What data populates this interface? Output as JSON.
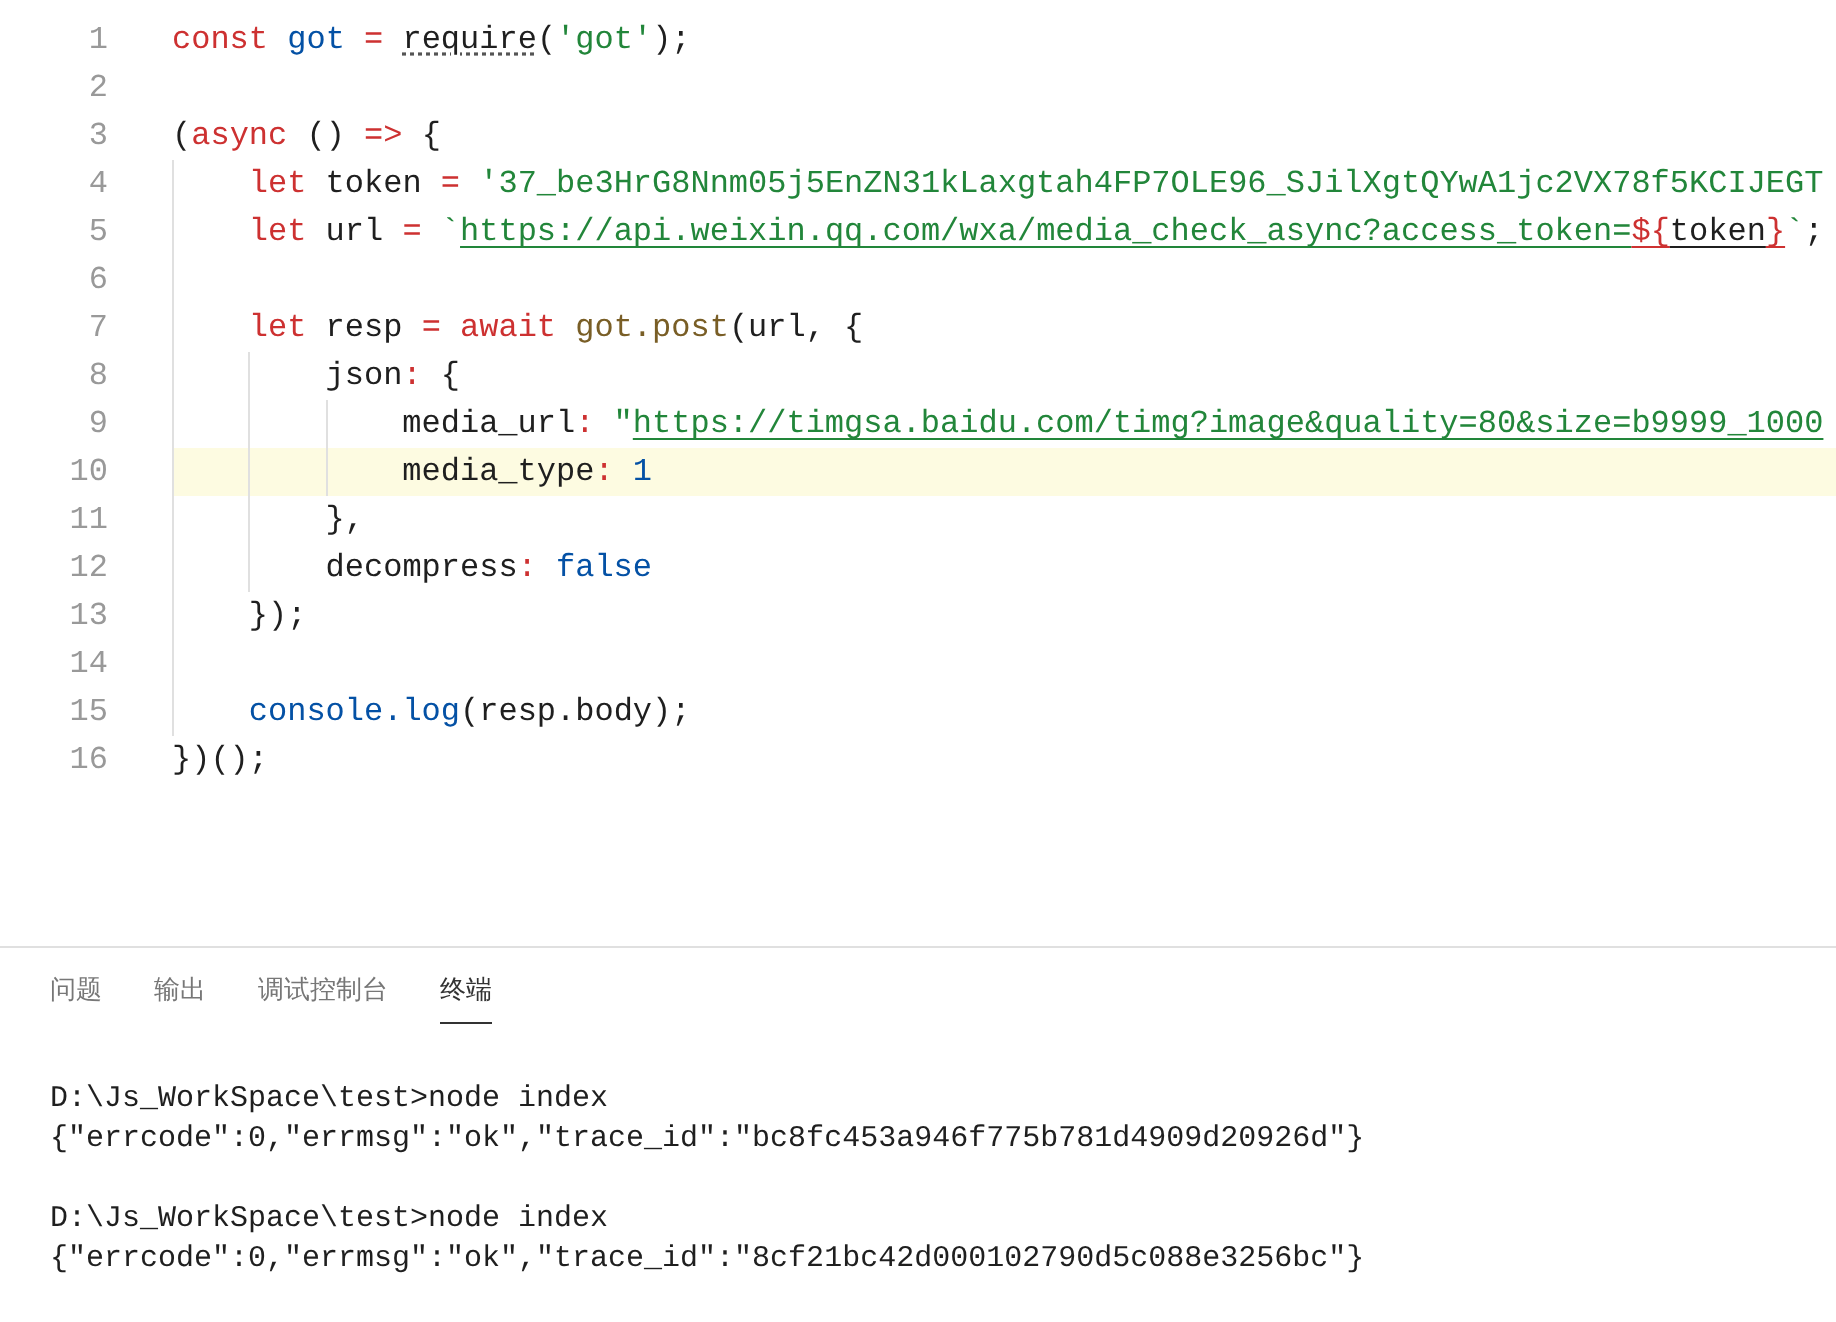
{
  "editor": {
    "lines": [
      {
        "number": "1",
        "current": false,
        "tokens": [
          {
            "kind": "kw",
            "text": "const "
          },
          {
            "kind": "var",
            "text": "got "
          },
          {
            "kind": "kw",
            "text": "= "
          },
          {
            "kind": "hint",
            "text": "require"
          },
          {
            "kind": "plain",
            "text": "("
          },
          {
            "kind": "str",
            "text": "'got'"
          },
          {
            "kind": "plain",
            "text": ");"
          }
        ]
      },
      {
        "number": "2",
        "current": false
      },
      {
        "number": "3",
        "current": false,
        "tokens": [
          {
            "kind": "plain",
            "text": "("
          },
          {
            "kind": "kw",
            "text": "async "
          },
          {
            "kind": "plain",
            "text": "() "
          },
          {
            "kind": "kw",
            "text": "=> "
          },
          {
            "kind": "plain",
            "text": "{"
          }
        ],
        "children": [
          {
            "number": "4",
            "current": false,
            "tokens": [
              {
                "kind": "kw",
                "text": "let "
              },
              {
                "kind": "plain",
                "text": "token "
              },
              {
                "kind": "kw",
                "text": "= "
              },
              {
                "kind": "str",
                "text": "'37_be3HrG8Nnm05j5EnZN31kLaxgtah4FP7OLE96_SJilXgtQYwA1jc2VX78f5KCIJEGT"
              }
            ]
          },
          {
            "number": "5",
            "current": false,
            "tokens": [
              {
                "kind": "kw",
                "text": "let "
              },
              {
                "kind": "plain",
                "text": "url "
              },
              {
                "kind": "kw",
                "text": "= "
              },
              {
                "kind": "str",
                "text": "`"
              },
              {
                "kind": "url",
                "text": "https://api.weixin.qq.com/wxa/media_check_async?access_token="
              },
              {
                "kind": "kwu",
                "text": "${"
              },
              {
                "kind": "plainu",
                "text": "token"
              },
              {
                "kind": "kwu",
                "text": "}"
              },
              {
                "kind": "str",
                "text": "`"
              },
              {
                "kind": "plain",
                "text": ";"
              }
            ]
          },
          {
            "number": "6",
            "current": false
          },
          {
            "number": "7",
            "current": false,
            "tokens": [
              {
                "kind": "kw",
                "text": "let "
              },
              {
                "kind": "plain",
                "text": "resp "
              },
              {
                "kind": "kw",
                "text": "= "
              },
              {
                "kind": "kw",
                "text": "await "
              },
              {
                "kind": "fn",
                "text": "got.post"
              },
              {
                "kind": "plain",
                "text": "(url, {"
              }
            ],
            "children": [
              {
                "number": "8",
                "current": false,
                "tokens": [
                  {
                    "kind": "plain",
                    "text": "json"
                  },
                  {
                    "kind": "kw",
                    "text": ": "
                  },
                  {
                    "kind": "plain",
                    "text": "{"
                  }
                ],
                "children": [
                  {
                    "number": "9",
                    "current": false,
                    "tokens": [
                      {
                        "kind": "plain",
                        "text": "media_url"
                      },
                      {
                        "kind": "kw",
                        "text": ": "
                      },
                      {
                        "kind": "str",
                        "text": "\""
                      },
                      {
                        "kind": "url",
                        "text": "https://timgsa.baidu.com/timg?image&quality=80&size=b9999_1000"
                      }
                    ]
                  },
                  {
                    "number": "10",
                    "current": true,
                    "tokens": [
                      {
                        "kind": "plain",
                        "text": "media_type"
                      },
                      {
                        "kind": "kw",
                        "text": ": "
                      },
                      {
                        "kind": "num",
                        "text": "1"
                      }
                    ]
                  }
                ]
              },
              {
                "number": "11",
                "current": false,
                "tokens": [
                  {
                    "kind": "plain",
                    "text": "},"
                  }
                ]
              },
              {
                "number": "12",
                "current": false,
                "tokens": [
                  {
                    "kind": "plain",
                    "text": "decompress"
                  },
                  {
                    "kind": "kw",
                    "text": ": "
                  },
                  {
                    "kind": "num",
                    "text": "false"
                  }
                ]
              }
            ]
          },
          {
            "number": "13",
            "current": false,
            "tokens": [
              {
                "kind": "plain",
                "text": "});"
              }
            ]
          },
          {
            "number": "14",
            "current": false
          },
          {
            "number": "15",
            "current": false,
            "tokens": [
              {
                "kind": "var",
                "text": "console.log"
              },
              {
                "kind": "plain",
                "text": "(resp.body);"
              }
            ]
          }
        ]
      },
      {
        "number": "16",
        "current": false,
        "tokens": [
          {
            "kind": "plain",
            "text": "})();"
          }
        ]
      }
    ]
  },
  "panel": {
    "tabs": [
      {
        "label": "问题",
        "selected": false
      },
      {
        "label": "输出",
        "selected": false
      },
      {
        "label": "调试控制台",
        "selected": false
      },
      {
        "label": "终端",
        "selected": true
      }
    ],
    "terminal": [
      {
        "kind": "command",
        "text": "D:\\Js_WorkSpace\\test>node index"
      },
      {
        "kind": "output",
        "text": "{\"errcode\":0,\"errmsg\":\"ok\",\"trace_id\":\"bc8fc453a946f775b781d4909d20926d\"}"
      },
      {
        "kind": "blank"
      },
      {
        "kind": "command",
        "text": "D:\\Js_WorkSpace\\test>node index"
      },
      {
        "kind": "output",
        "text": "{\"errcode\":0,\"errmsg\":\"ok\",\"trace_id\":\"8cf21bc42d000102790d5c088e3256bc\"}"
      }
    ]
  }
}
